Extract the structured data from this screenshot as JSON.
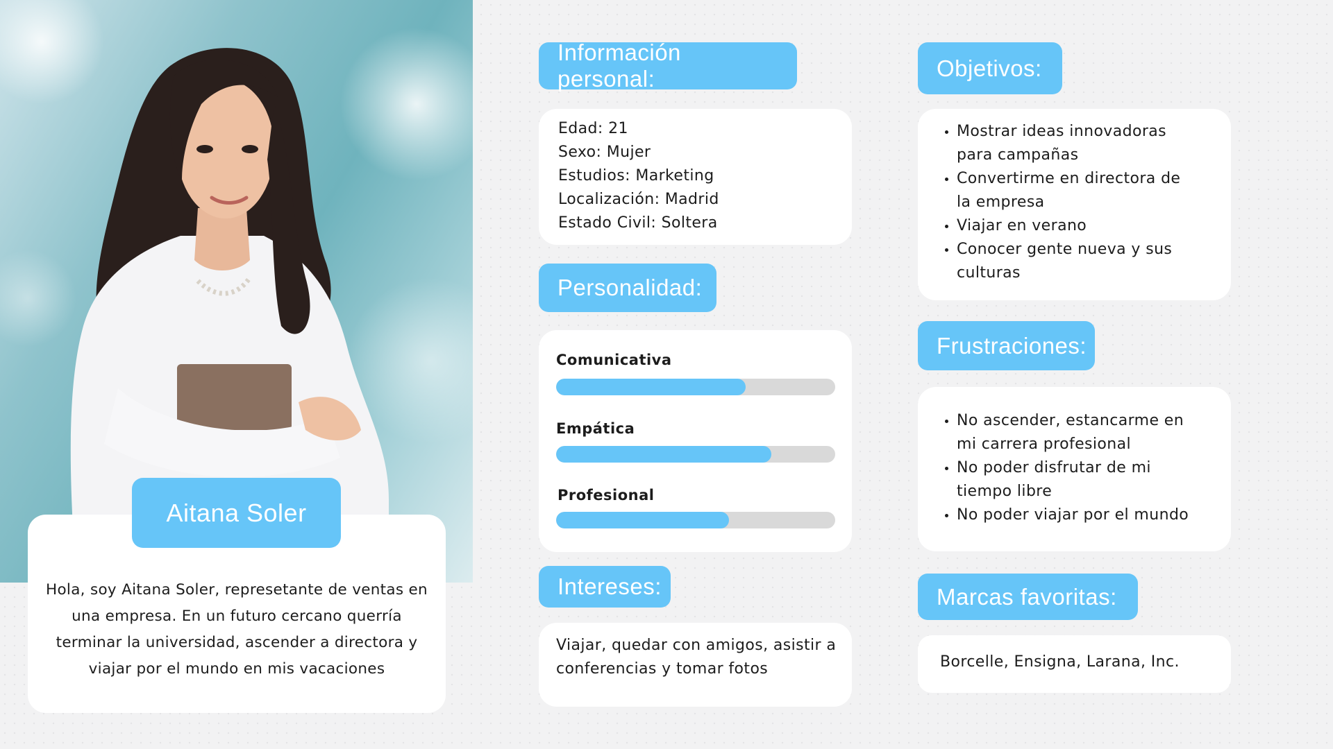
{
  "persona": {
    "name": "Aitana Soler",
    "bio": "Hola, soy Aitana Soler, represetante de ventas en una empresa. En un futuro cercano querría terminar la universidad, ascender a directora y viajar por el mundo en mis vacaciones"
  },
  "personal_info": {
    "title": "Información personal:",
    "lines": [
      "Edad: 21",
      "Sexo: Mujer",
      "Estudios: Marketing",
      "Localización: Madrid",
      "Estado Civil: Soltera"
    ]
  },
  "personality": {
    "title": "Personalidad:",
    "traits": [
      {
        "label": "Comunicativa",
        "level": 0.68
      },
      {
        "label": "Empática",
        "level": 0.77
      },
      {
        "label": "Profesional",
        "level": 0.62
      }
    ]
  },
  "interests": {
    "title": "Intereses:",
    "text": "Viajar, quedar con amigos, asistir a conferencias y tomar fotos"
  },
  "objectives": {
    "title": "Objetivos:",
    "items": [
      "Mostrar ideas innovadoras para campañas",
      "Convertirme en directora de la empresa",
      "Viajar en verano",
      "Conocer gente nueva y sus culturas"
    ]
  },
  "frustrations": {
    "title": "Frustraciones:",
    "items": [
      "No ascender, estancarme en mi carrera profesional",
      "No poder disfrutar de mi tiempo libre",
      "No poder viajar por el mundo"
    ]
  },
  "brands": {
    "title": "Marcas favoritas:",
    "text": "Borcelle, Ensigna, Larana, Inc."
  },
  "colors": {
    "accent": "#66c5f8",
    "card": "#ffffff",
    "track": "#d9d9d9"
  }
}
